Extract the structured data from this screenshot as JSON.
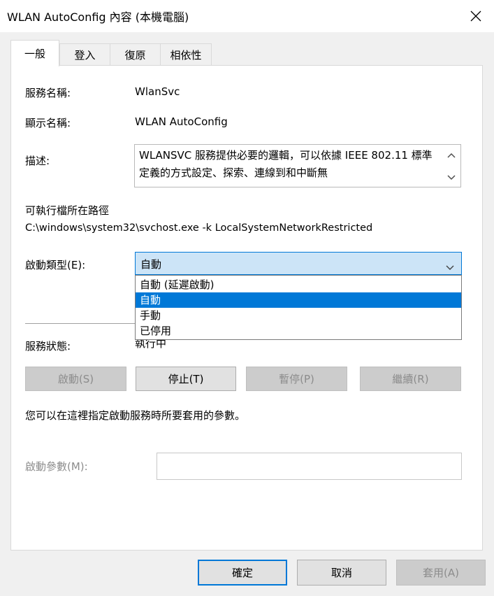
{
  "window": {
    "title": "WLAN AutoConfig 內容 (本機電腦)"
  },
  "tabs": [
    {
      "label": "一般"
    },
    {
      "label": "登入"
    },
    {
      "label": "復原"
    },
    {
      "label": "相依性"
    }
  ],
  "general": {
    "service_name_label": "服務名稱:",
    "service_name_value": "WlanSvc",
    "display_name_label": "顯示名稱:",
    "display_name_value": "WLAN AutoConfig",
    "description_label": "描述:",
    "description_value": "WLANSVC 服務提供必要的邏輯，可以依據 IEEE 802.11 標準定義的方式設定、探索、連線到和中斷無",
    "exe_path_label": "可執行檔所在路徑",
    "exe_path_value": "C:\\windows\\system32\\svchost.exe -k LocalSystemNetworkRestricted",
    "startup_type_label": "啟動類型(E):",
    "startup_type_value": "自動",
    "startup_type_options": [
      "自動 (延遲啟動)",
      "自動",
      "手動",
      "已停用"
    ],
    "service_status_label": "服務狀態:",
    "service_status_value": "執行中",
    "buttons": {
      "start": "啟動(S)",
      "stop": "停止(T)",
      "pause": "暫停(P)",
      "resume": "繼續(R)"
    },
    "params_hint": "您可以在這裡指定啟動服務時所要套用的參數。",
    "start_params_label": "啟動參數(M):",
    "start_params_value": ""
  },
  "footer": {
    "ok": "確定",
    "cancel": "取消",
    "apply": "套用(A)"
  }
}
